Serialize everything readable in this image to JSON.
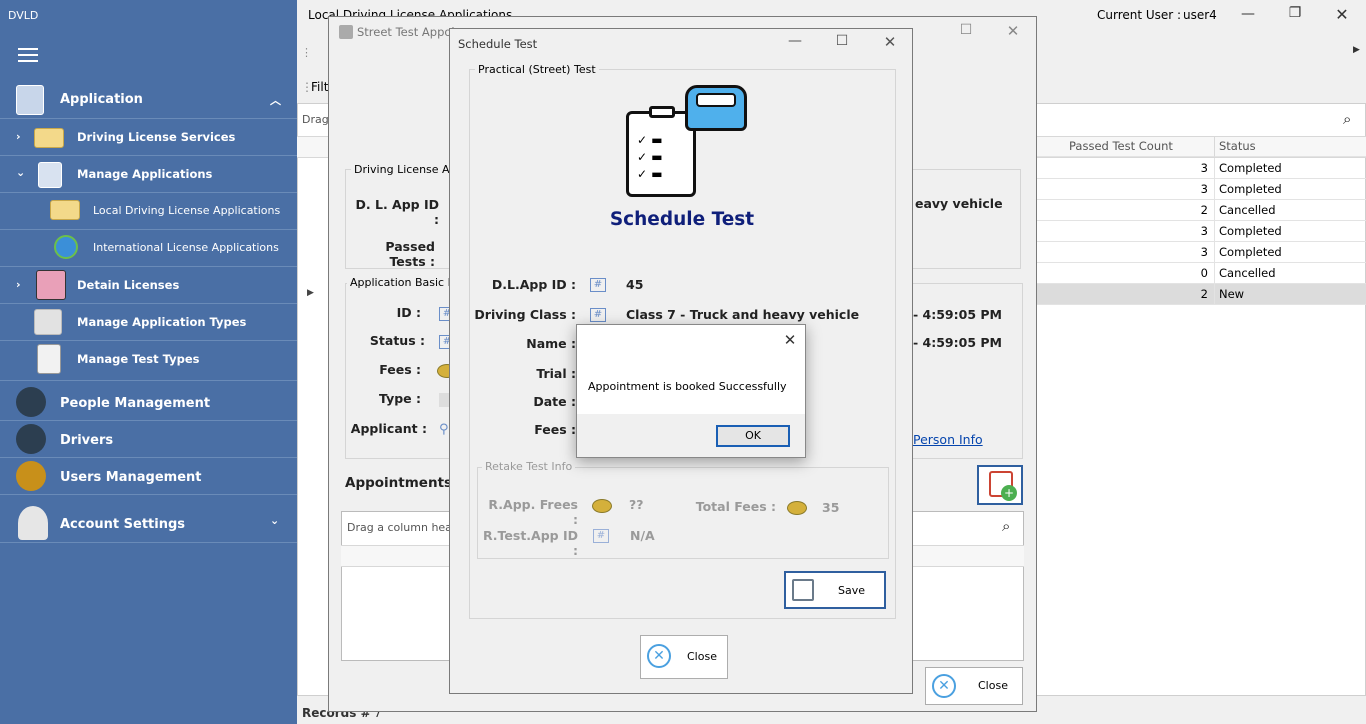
{
  "app": {
    "title": "DVLD"
  },
  "sidebar": {
    "application_label": "Application",
    "items": [
      {
        "label": "Driving License Services"
      },
      {
        "label": "Manage Applications"
      },
      {
        "label": "Local Driving License Applications"
      },
      {
        "label": "International License Applications"
      },
      {
        "label": "Detain Licenses"
      },
      {
        "label": "Manage Application Types"
      },
      {
        "label": "Manage Test Types"
      }
    ],
    "people_label": "People Management",
    "drivers_label": "Drivers",
    "users_label": "Users Management",
    "account_label": "Account Settings"
  },
  "header": {
    "title": "Local Driving License Applications",
    "current_user_label": "Current User :",
    "current_user": "user4"
  },
  "main": {
    "filter_label": "Filt",
    "drag_label": "Drag",
    "records_label": "Records #",
    "records_count": "7",
    "grid": {
      "columns": [
        "Passed Test Count",
        "Status"
      ],
      "rows": [
        {
          "passed": "3",
          "status": "Completed"
        },
        {
          "passed": "3",
          "status": "Completed"
        },
        {
          "passed": "2",
          "status": "Cancelled"
        },
        {
          "passed": "3",
          "status": "Completed"
        },
        {
          "passed": "3",
          "status": "Completed"
        },
        {
          "passed": "0",
          "status": "Cancelled"
        },
        {
          "passed": "2",
          "status": "New"
        }
      ]
    }
  },
  "street_window": {
    "title": "Street Test Appoi",
    "dl_group_label": "Driving License Appl",
    "dl_app_id_label": "D. L. App ID :",
    "passed_tests_label": "Passed Tests :",
    "class_partial": "eavy vehicle",
    "basic_group_label": "Application Basic Info",
    "id_label": "ID :",
    "status_label": "Status :",
    "fees_label": "Fees :",
    "type_label": "Type :",
    "applicant_label": "Applicant :",
    "date1": "- 4:59:05 PM",
    "date2": "- 4:59:05 PM",
    "person_info_link": "Person Info",
    "appointments_label": "Appointments",
    "drag_header": "Drag a column header",
    "close_label": "Close"
  },
  "schedule_window": {
    "title": "Schedule Test",
    "group_label": "Practical (Street) Test",
    "heading": "Schedule Test",
    "dl_app_id_label": "D.L.App ID :",
    "dl_app_id": "45",
    "class_label": "Driving Class :",
    "class_value": "Class 7 - Truck and heavy vehicle",
    "name_label": "Name :",
    "trial_label": "Trial :",
    "date_label": "Date :",
    "fees_label": "Fees :",
    "retake_group_label": "Retake Test Info",
    "rapp_fees_label": "R.App. Frees :",
    "rapp_fees_value": "??",
    "total_fees_label": "Total Fees :",
    "total_fees_value": "35",
    "rtest_label": "R.Test.App ID :",
    "rtest_value": "N/A",
    "save_label": "Save",
    "close_label": "Close"
  },
  "message_box": {
    "message": "Appointment is booked Successfully",
    "ok_label": "OK"
  }
}
